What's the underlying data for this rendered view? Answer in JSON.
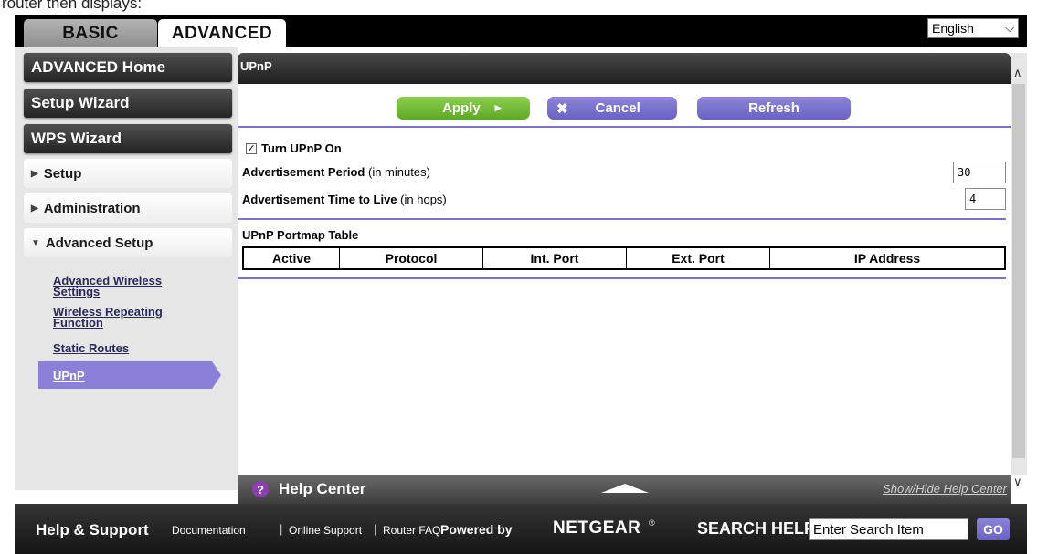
{
  "caption": "router then displays:",
  "tabs": {
    "basic": "BASIC",
    "advanced": "ADVANCED"
  },
  "language": "English",
  "sidebar": {
    "advanced_home": "ADVANCED Home",
    "setup_wizard": "Setup Wizard",
    "wps_wizard": "WPS Wizard",
    "setup": "Setup",
    "administration": "Administration",
    "advanced_setup": "Advanced Setup",
    "sub_items": {
      "adv_wireless": "Advanced Wireless Settings",
      "wireless_repeating": "Wireless Repeating Function",
      "static_routes": "Static Routes",
      "upnp": "UPnP"
    }
  },
  "panel": {
    "title": "UPnP",
    "apply": "Apply",
    "cancel": "Cancel",
    "refresh": "Refresh",
    "turn_on": "Turn UPnP On",
    "adv_period_label": "Advertisement Period",
    "adv_period_unit": "(in minutes)",
    "adv_period_value": "30",
    "adv_ttl_label": "Advertisement Time to Live",
    "adv_ttl_unit": "(in hops)",
    "adv_ttl_value": "4",
    "portmap_title": "UPnP Portmap Table",
    "columns": {
      "active": "Active",
      "protocol": "Protocol",
      "int_port": "Int. Port",
      "ext_port": "Ext. Port",
      "ip": "IP Address"
    }
  },
  "help_center": {
    "title": "Help Center",
    "toggle": "Show/Hide Help Center"
  },
  "footer": {
    "help_support": "Help & Support",
    "documentation": "Documentation",
    "online_support": "Online Support",
    "router_faq": "Router FAQ",
    "sep": "|",
    "powered_by": "Powered by",
    "brand": "NETGEAR",
    "reg": "®",
    "search_help": "SEARCH HELP",
    "search_placeholder": "Enter Search Item",
    "go": "GO"
  },
  "colors": {
    "accent_purple": "#7a72cc",
    "apply_green": "#6cb834",
    "header_dark": "#2a2a2a",
    "sidebar_bg": "#e6e6e6"
  }
}
